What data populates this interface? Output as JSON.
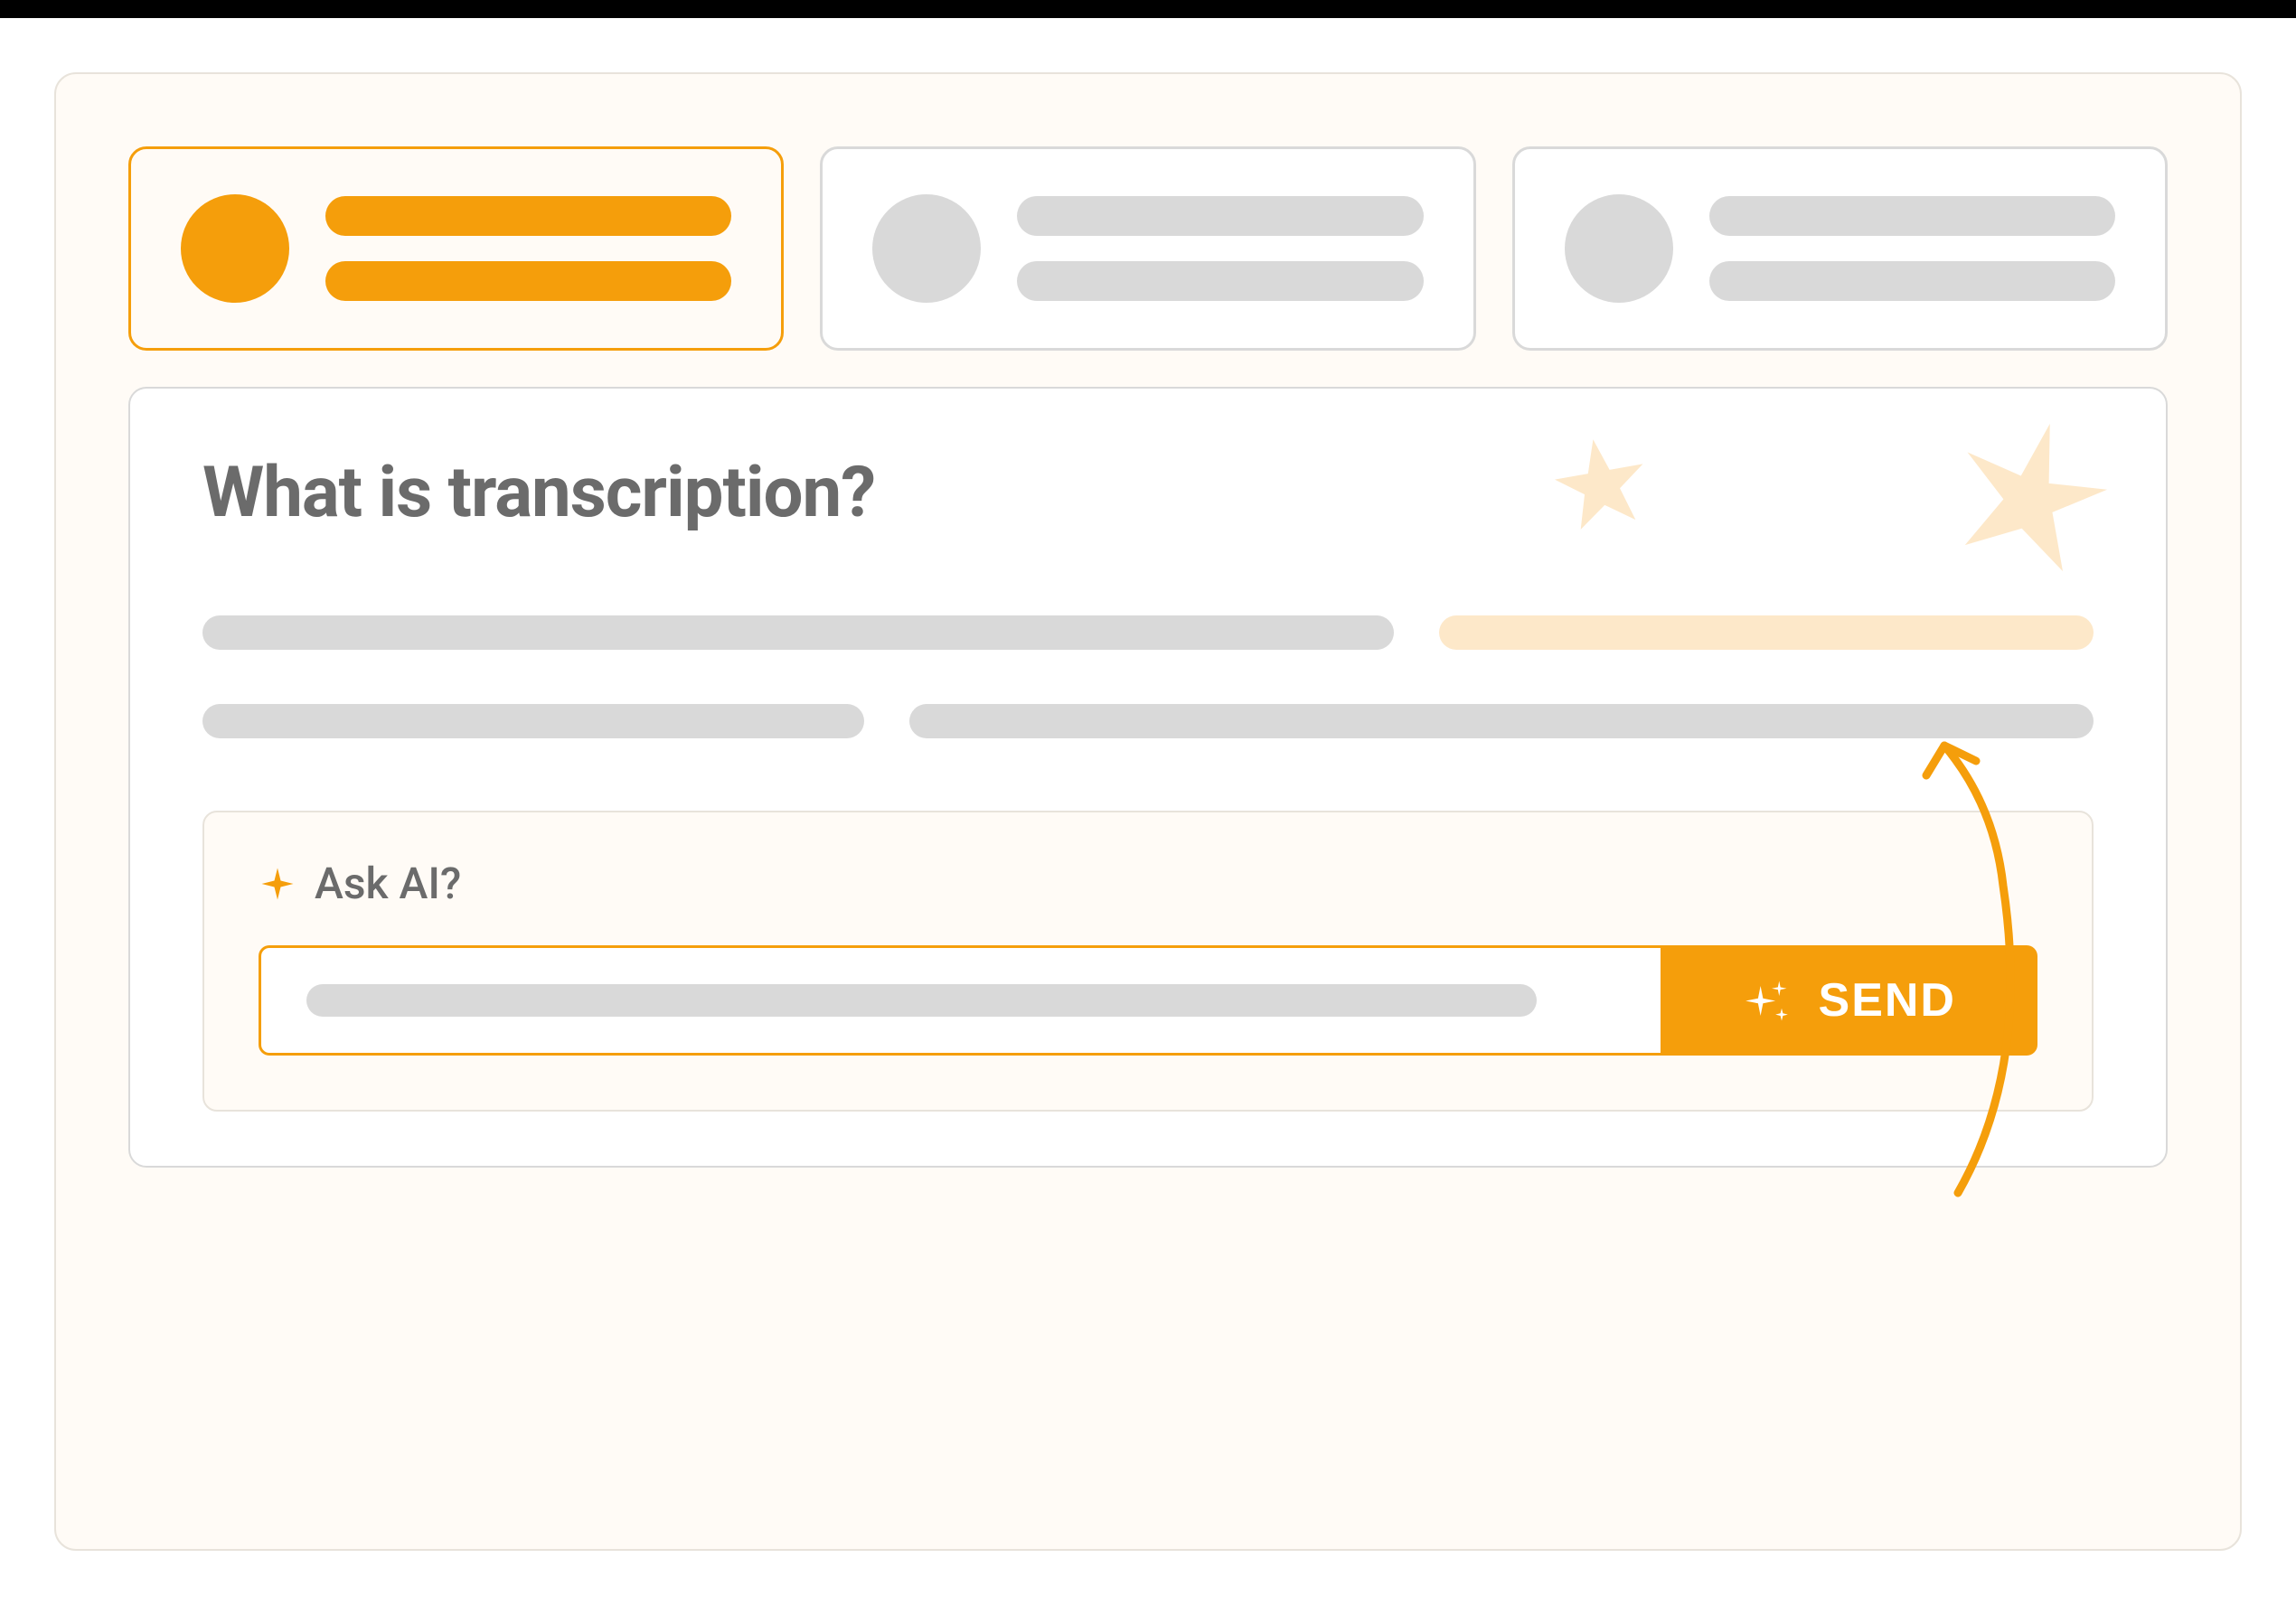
{
  "cards": [
    {
      "active": true
    },
    {
      "active": false
    },
    {
      "active": false
    }
  ],
  "panel": {
    "title": "What is transcription?"
  },
  "ask_ai": {
    "label": "Ask AI?",
    "send_label": "SEND"
  },
  "colors": {
    "accent": "#F59E0B",
    "muted": "#D9D9D9",
    "highlight": "#FDE8C9",
    "text": "#6B6B6B"
  }
}
